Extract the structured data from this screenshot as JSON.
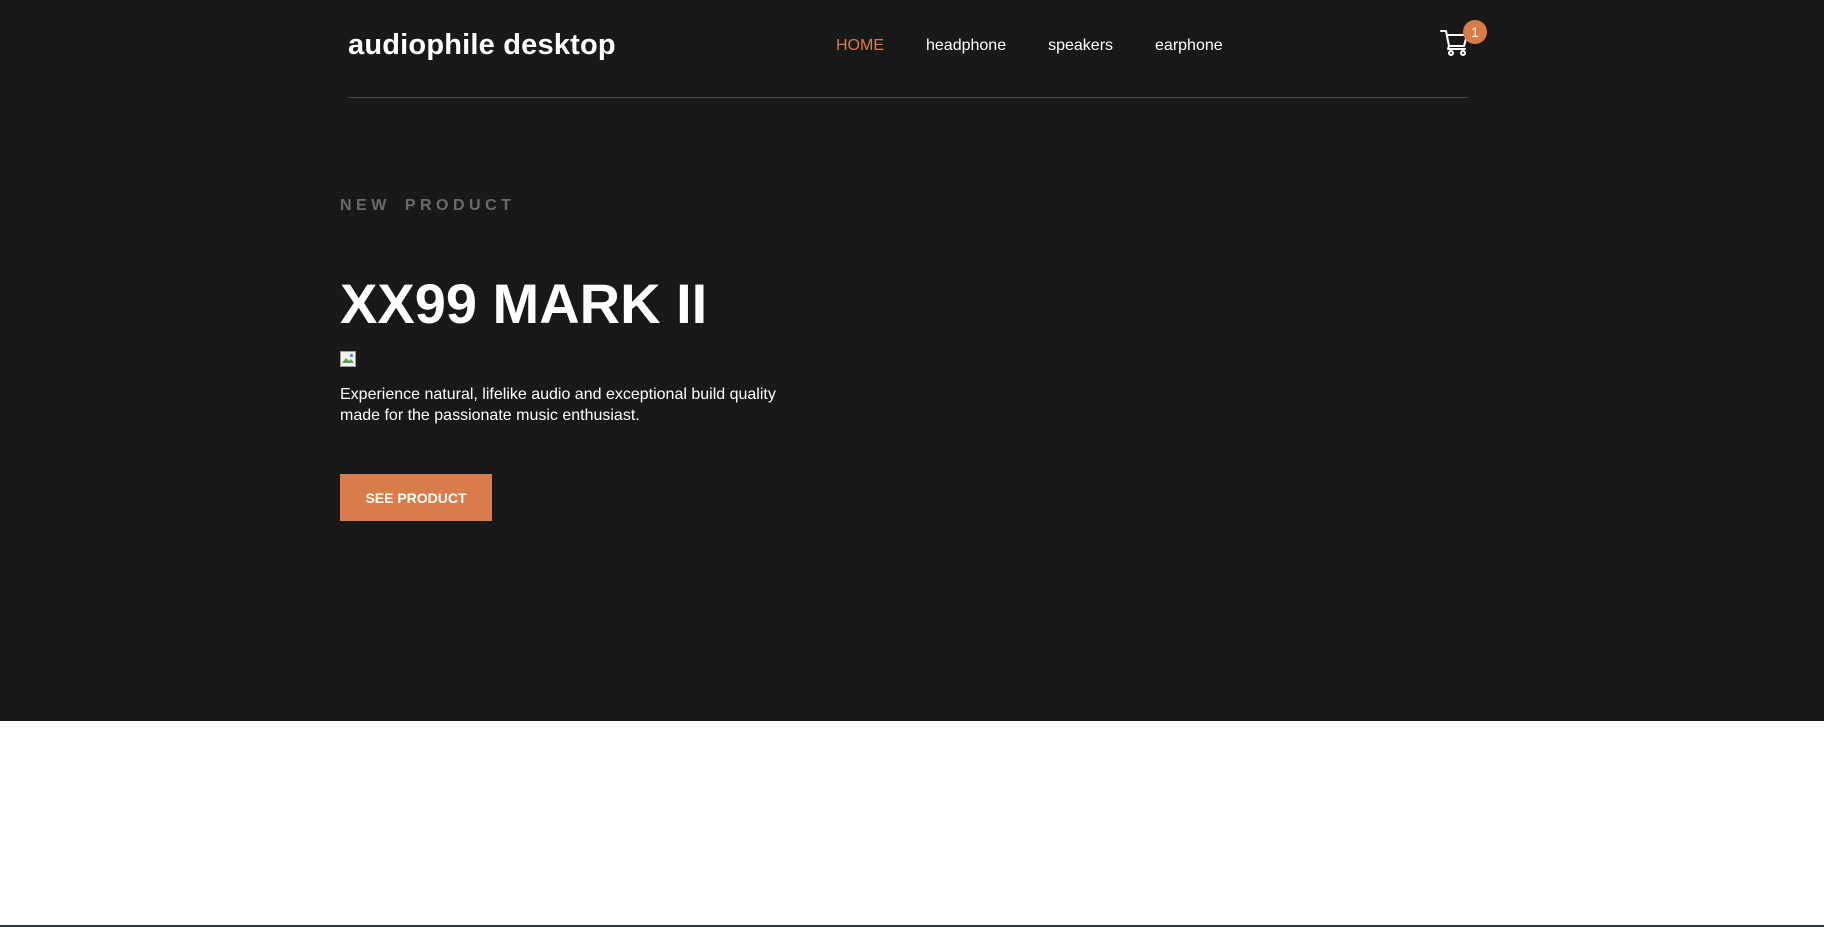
{
  "header": {
    "logo": "audiophile desktop",
    "nav": [
      {
        "label": "HOME",
        "active": true
      },
      {
        "label": "headphone",
        "active": false
      },
      {
        "label": "speakers",
        "active": false
      },
      {
        "label": "earphone",
        "active": false
      }
    ],
    "cart": {
      "icon": "cart-icon",
      "count": "1"
    }
  },
  "hero": {
    "eyebrow_word1": "NEW",
    "eyebrow_word2": "PRODUCT",
    "title": "XX99 MARK II",
    "image_icon": "broken-image-icon",
    "description": "Experience natural, lifelike audio and exceptional build quality made for the passionate music enthusiast.",
    "cta_label": "SEE PRODUCT"
  },
  "colors": {
    "accent": "#d87d4a",
    "hero_bg": "#191919",
    "text": "#ffffff",
    "eyebrow": "#6b6b6b"
  }
}
